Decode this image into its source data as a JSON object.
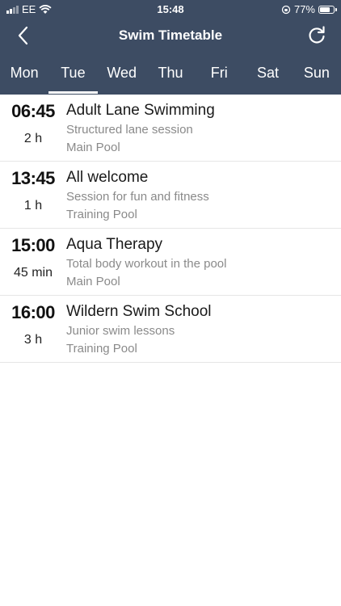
{
  "status_bar": {
    "carrier": "EE",
    "time": "15:48",
    "battery": "77%",
    "battery_level": 0.77
  },
  "nav": {
    "title": "Swim Timetable"
  },
  "days": [
    {
      "label": "Mon"
    },
    {
      "label": "Tue"
    },
    {
      "label": "Wed"
    },
    {
      "label": "Thu"
    },
    {
      "label": "Fri"
    },
    {
      "label": "Sat"
    },
    {
      "label": "Sun"
    }
  ],
  "selected_day": "Tue",
  "sessions": [
    {
      "time": "06:45",
      "duration": "2 h",
      "name": "Adult Lane Swimming",
      "description": "Structured lane session",
      "pool": "Main Pool"
    },
    {
      "time": "13:45",
      "duration": "1 h",
      "name": "All welcome",
      "description": "Session for fun and fitness",
      "pool": "Training Pool"
    },
    {
      "time": "15:00",
      "duration": "45 min",
      "name": "Aqua Therapy",
      "description": "Total body workout in the pool",
      "pool": "Main Pool"
    },
    {
      "time": "16:00",
      "duration": "3 h",
      "name": "Wildern Swim School",
      "description": "Junior swim lessons",
      "pool": "Training Pool"
    }
  ],
  "colors": {
    "header": "#3d4c63",
    "divider": "#e6e6e6",
    "secondary_text": "#8a8a8a"
  }
}
